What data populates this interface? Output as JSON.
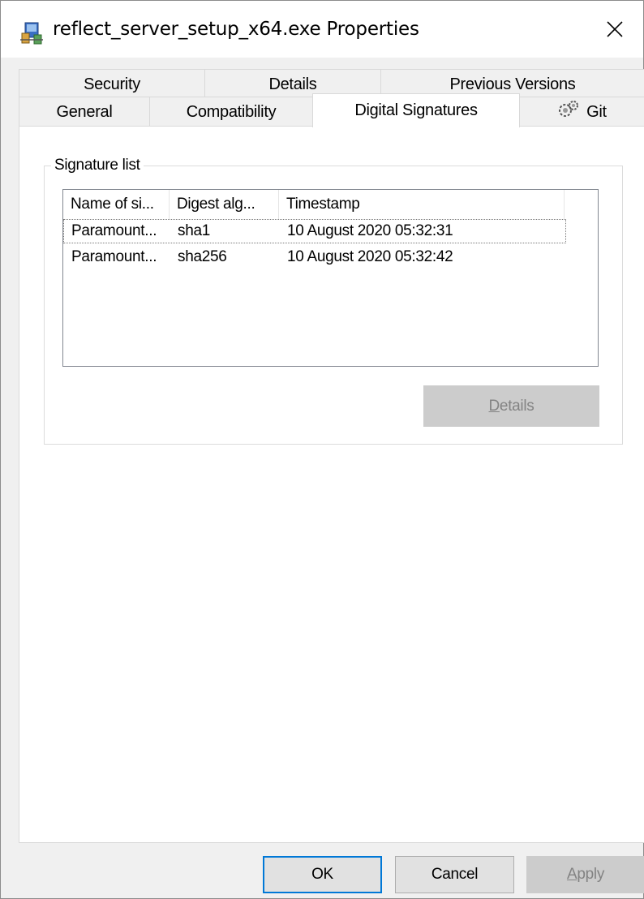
{
  "window": {
    "title": "reflect_server_setup_x64.exe Properties",
    "close_glyph": "✕"
  },
  "tabs": {
    "row1": [
      {
        "label": "Security"
      },
      {
        "label": "Details"
      },
      {
        "label": "Previous Versions"
      }
    ],
    "row2": [
      {
        "label": "General"
      },
      {
        "label": "Compatibility"
      },
      {
        "label": "Digital Signatures",
        "active": true
      },
      {
        "label": "Git",
        "icon": "git-icon"
      }
    ]
  },
  "signatures": {
    "group_label": "Signature list",
    "columns": [
      "Name of si...",
      "Digest alg...",
      "Timestamp"
    ],
    "rows": [
      {
        "name": "Paramount...",
        "digest": "sha1",
        "timestamp": "10 August 2020 05:32:31",
        "focused": true
      },
      {
        "name": "Paramount...",
        "digest": "sha256",
        "timestamp": "10 August 2020 05:32:42",
        "focused": false
      }
    ],
    "details_button": {
      "mnemonic": "D",
      "rest": "etails",
      "enabled": false
    }
  },
  "footer": {
    "ok_label": "OK",
    "cancel_label": "Cancel",
    "apply_button": {
      "mnemonic": "A",
      "rest": "pply",
      "enabled": false
    }
  },
  "colors": {
    "window_bg": "#f0f0f0",
    "page_bg": "#ffffff",
    "focus_border": "#0078d7",
    "disabled_button_bg": "#cccccc",
    "disabled_text": "#838383"
  }
}
